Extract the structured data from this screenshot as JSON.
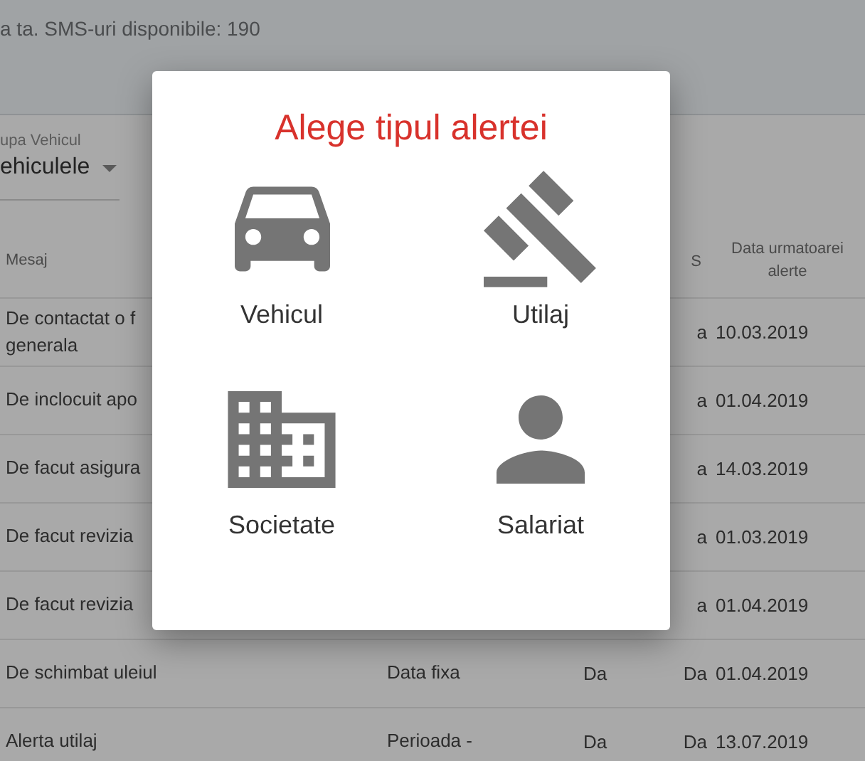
{
  "header": {
    "text": "a ta. SMS-uri disponibile: 190"
  },
  "filters": [
    {
      "label": "upa Vehicul",
      "value": "ehiculele"
    }
  ],
  "table": {
    "header": {
      "mesaj": "Mesaj",
      "column_4": "S",
      "next_date": "Data urmatoarei alerte"
    },
    "rows": [
      {
        "mesaj": "De contactat o f",
        "mesaj_line_2": "generala",
        "column_4": "a",
        "next_date": "10.03.2019"
      },
      {
        "mesaj": "De inclocuit apo",
        "column_4": "a",
        "next_date": "01.04.2019"
      },
      {
        "mesaj": "De facut asigura",
        "column_4": "a",
        "next_date": "14.03.2019"
      },
      {
        "mesaj": "De facut revizia",
        "column_4": "a",
        "next_date": "01.03.2019"
      },
      {
        "mesaj": "De facut revizia",
        "column_4": "a",
        "next_date": "01.04.2019"
      },
      {
        "mesaj": "De schimbat uleiul",
        "column_2": "Data fixa",
        "column_3": "Da",
        "column_4": "Da",
        "next_date": "01.04.2019"
      },
      {
        "mesaj": "Alerta utilaj",
        "column_2": "Perioada -",
        "column_3": "Da",
        "column_4": "Da",
        "next_date": "13.07.2019"
      }
    ]
  },
  "dialog": {
    "title": "Alege tipul alertei",
    "options": [
      {
        "kind": "vehicle",
        "label": "Vehicul"
      },
      {
        "kind": "machine",
        "label": "Utilaj"
      },
      {
        "kind": "company",
        "label": "Societate"
      },
      {
        "kind": "employee",
        "label": "Salariat"
      }
    ]
  }
}
